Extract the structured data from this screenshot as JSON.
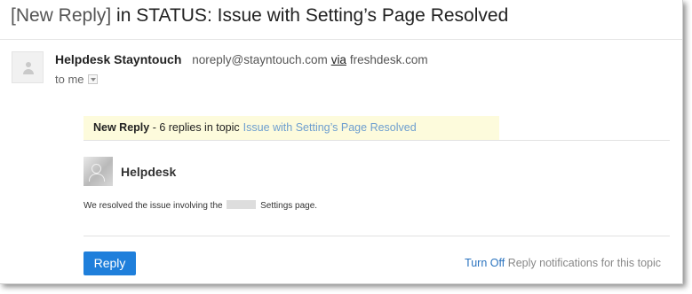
{
  "subject": {
    "prefix": "[New Reply]",
    "middle": " in STATUS: Issue with Setting’s Page Resolved"
  },
  "sender": {
    "name": "Helpdesk Stayntouch",
    "email": "noreply@stayntouch.com",
    "via": "via",
    "domain": "freshdesk.com",
    "to": "to me"
  },
  "banner": {
    "title": "New Reply",
    "replies": " - 6 replies in topic",
    "topic": "Issue with Setting’s Page Resolved"
  },
  "post": {
    "author": "Helpdesk",
    "message_before": "We resolved the issue involving the",
    "message_after": "Settings page."
  },
  "actions": {
    "reply": "Reply",
    "turn_off": "Turn Off",
    "turn_off_rest": " Reply notifications for this topic"
  },
  "colors": {
    "reply_button": "#1f7fdb",
    "link": "#2a73bf",
    "banner_bg": "#fdfbdc",
    "topic_link": "#6d9ecf"
  }
}
